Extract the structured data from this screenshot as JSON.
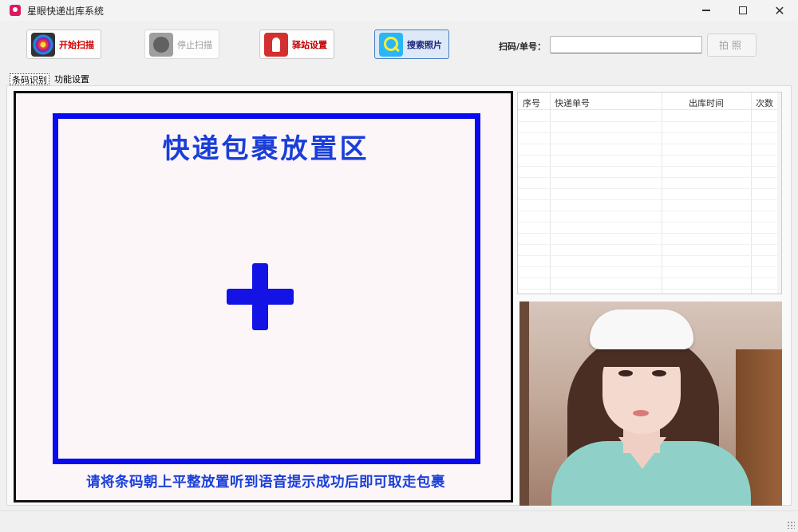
{
  "window": {
    "title": "星眼快递出库系统",
    "controls": {
      "minimize": "",
      "maximize": "",
      "close": "✕"
    }
  },
  "toolbar": {
    "start_scan": "开始扫描",
    "stop_scan": "停止扫描",
    "station_settings": "驿站设置",
    "search_photos": "搜索照片",
    "scan_label": "扫码/单号：",
    "scan_input_value": "",
    "take_photo": "拍照"
  },
  "tabs": [
    {
      "label": "条码识别",
      "active": true
    },
    {
      "label": "功能设置",
      "active": false
    }
  ],
  "placement_zone": {
    "title": "快递包裹放置区",
    "hint": "请将条码朝上平整放置听到语音提示成功后即可取走包裹",
    "accent_color": "#1313e6"
  },
  "record_list": {
    "columns": [
      "序号",
      "快递单号",
      "出库时间",
      "次数"
    ],
    "rows": []
  },
  "photo": {
    "subject": "nurse-photo"
  }
}
